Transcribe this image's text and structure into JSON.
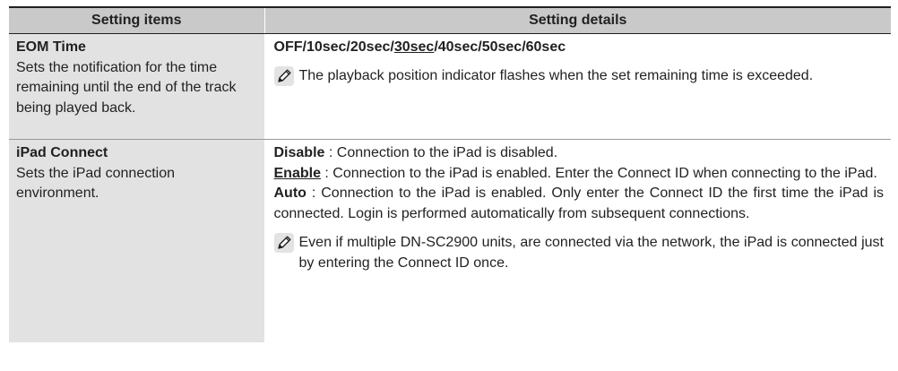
{
  "header": {
    "col1": "Setting items",
    "col2": "Setting details"
  },
  "rows": [
    {
      "title": "EOM Time",
      "description": "Sets the notification for the time remaining until the end of the track being played back.",
      "options": {
        "before": "OFF/10sec/20sec/",
        "default": "30sec",
        "after": "/40sec/50sec/60sec"
      },
      "note": "The playback position indicator flashes when the set remaining time is exceeded."
    },
    {
      "title": "iPad Connect",
      "description": "Sets the iPad connection environment.",
      "options": [
        {
          "name": "Disable",
          "text": " : Connection to the iPad is disabled."
        },
        {
          "name": "Enable",
          "text": " : Connection to the iPad is enabled. Enter the Connect ID when connecting to the iPad."
        },
        {
          "name": "Auto",
          "text": " : Connection to the iPad is enabled. Only enter the Connect ID the first time the iPad is connected. Login is performed automatically from subsequent connections."
        }
      ],
      "note": "Even if multiple DN-SC2900 units, are connected via the network, the iPad is connected just by entering the Connect ID once."
    }
  ],
  "icons": {
    "note": "pencil-note-icon"
  }
}
